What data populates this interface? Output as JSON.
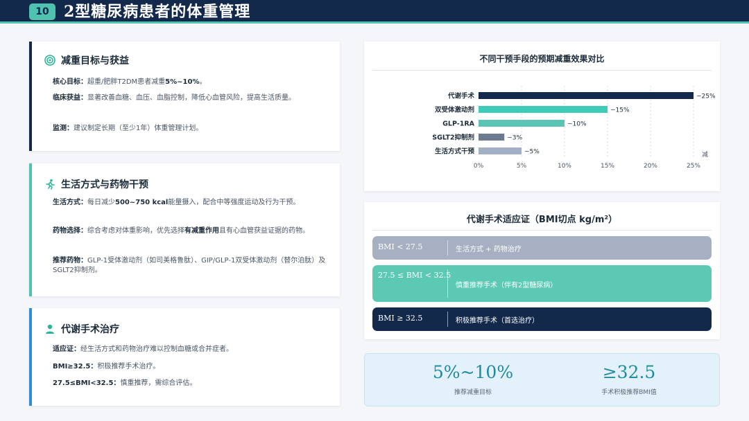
{
  "header": {
    "page_number": "10",
    "title": "2型糖尿病患者的体重管理"
  },
  "left": {
    "card1": {
      "title": "减重目标与获益",
      "icon": "target-icon",
      "accent": "#13294b",
      "lines": [
        {
          "label": "核心目标：",
          "text_a": "超重/肥胖T2DM患者减重",
          "strong": "5%~10%",
          "text_b": "。"
        },
        {
          "label": "临床获益：",
          "text": "显著改善血糖、血压、血脂控制，降低心血管风险，提高生活质量。"
        },
        {
          "label": "监测：",
          "text": "建议制定长期（至少1年）体重管理计划。"
        }
      ]
    },
    "card2": {
      "title": "生活方式与药物干预",
      "icon": "running-icon",
      "accent": "#4fc3b0",
      "lines": [
        {
          "label": "生活方式：",
          "text_a": "每日减少",
          "strong": "500~750 kcal",
          "text_b": "能量摄入，配合中等强度运动及行为干预。"
        },
        {
          "label": "药物选择：",
          "text_a": "综合考虑对体重影响，优先选择",
          "strong": "有减重作用",
          "text_b": "且有心血管获益证据的药物。"
        },
        {
          "label": "推荐药物：",
          "text": "GLP-1受体激动剂（如司美格鲁肽）、GIP/GLP-1双受体激动剂（替尔泊肽）及SGLT2抑制剂。"
        }
      ]
    },
    "card3": {
      "title": "代谢手术治疗",
      "icon": "user-icon",
      "accent": "#2f8fd6",
      "lines": [
        {
          "label": "适应证：",
          "text": "经生活方式和药物治疗难以控制血糖或合并症者。"
        },
        {
          "label": "BMI≥32.5：",
          "text": "积极推荐手术治疗。"
        },
        {
          "label": "27.5≤BMI<32.5：",
          "text": "慎重推荐，需综合评估。"
        }
      ]
    }
  },
  "chart_data": {
    "type": "bar",
    "orientation": "horizontal",
    "title": "不同干预手段的预期减重效果对比",
    "categories": [
      "代谢手术",
      "双受体激动剂",
      "GLP-1RA",
      "SGLT2抑制剂",
      "生活方式干预"
    ],
    "values": [
      25,
      15,
      10,
      3,
      5
    ],
    "value_labels": [
      "~25%",
      "~15%",
      "~10%",
      "~3%",
      "~5%"
    ],
    "colors": [
      "#13294b",
      "#3ecbb7",
      "#5cc4b4",
      "#6e7a8f",
      "#a3afc5"
    ],
    "xlim": [
      0,
      25
    ],
    "xticks": [
      "0%",
      "5%",
      "10%",
      "15%",
      "20%",
      "25%"
    ],
    "xlabel": "减",
    "grid": "vertical-dashed"
  },
  "bmi": {
    "title": "代谢手术适应证（BMI切点 kg/m²）",
    "rows": [
      {
        "key": "BMI < 27.5",
        "value": "生活方式 + 药物治疗",
        "bg": "#a6b0c2",
        "fg": "#ffffff"
      },
      {
        "key": "27.5 ≤ BMI < 32.5",
        "value": "慎重推荐手术（伴有2型糖尿病）",
        "bg": "#5cc9b5",
        "fg": "#ffffff"
      },
      {
        "key": "BMI ≥ 32.5",
        "value": "积极推荐手术（首选治疗）",
        "bg": "#13294b",
        "fg": "#ffffff"
      }
    ]
  },
  "stats": [
    {
      "value": "5%~10%",
      "label": "推荐减重目标"
    },
    {
      "value": "≥32.5",
      "label": "手术积极推荐BMI值"
    }
  ]
}
